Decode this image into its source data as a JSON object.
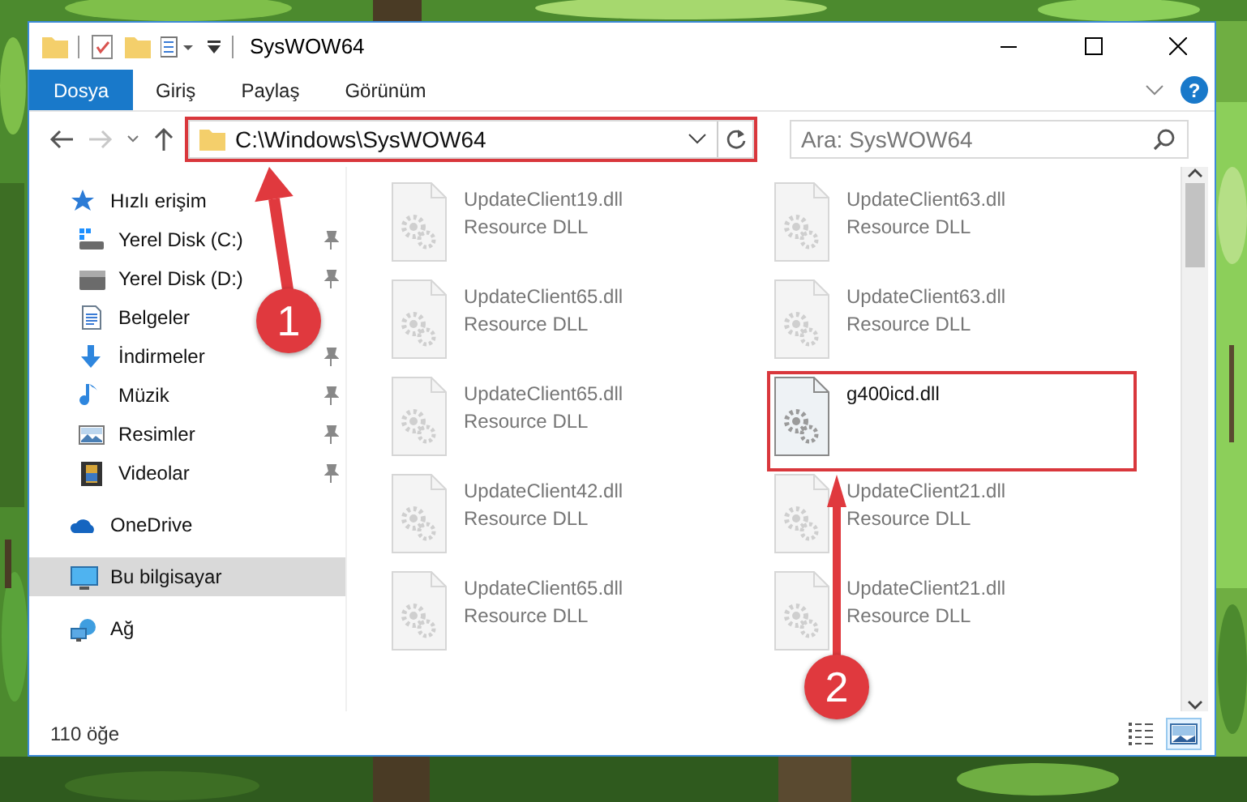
{
  "window": {
    "title": "SysWOW64"
  },
  "ribbon_tabs": [
    {
      "label": "Dosya",
      "selected": true
    },
    {
      "label": "Giriş",
      "selected": false
    },
    {
      "label": "Paylaş",
      "selected": false
    },
    {
      "label": "Görünüm",
      "selected": false
    }
  ],
  "help_button": {
    "label": "?"
  },
  "navigation": {
    "forward_disabled": true
  },
  "address_bar": {
    "path": "C:\\Windows\\SysWOW64",
    "highlighted": true
  },
  "search": {
    "placeholder": "Ara: SysWOW64"
  },
  "sidebar": {
    "items": [
      {
        "label": "Hızlı erişim",
        "kind": "star",
        "selected": false,
        "children": [
          {
            "label": "Yerel Disk (C:)",
            "kind": "drive-system",
            "pinned": true
          },
          {
            "label": "Yerel Disk (D:)",
            "kind": "drive",
            "pinned": true
          },
          {
            "label": "Belgeler",
            "kind": "documents"
          },
          {
            "label": "İndirmeler",
            "kind": "downloads",
            "pinned": true
          },
          {
            "label": "Müzik",
            "kind": "music",
            "pinned": true
          },
          {
            "label": "Resimler",
            "kind": "pictures",
            "pinned": true
          },
          {
            "label": "Videolar",
            "kind": "videos",
            "pinned": true
          }
        ]
      },
      {
        "label": "OneDrive",
        "kind": "cloud",
        "selected": false
      },
      {
        "label": "Bu bilgisayar",
        "kind": "computer",
        "selected": true
      },
      {
        "label": "Ağ",
        "kind": "network",
        "selected": false
      }
    ]
  },
  "files": [
    {
      "name": "UpdateClient19.dll",
      "type": "Resource DLL",
      "faded": true
    },
    {
      "name": "UpdateClient63.dll",
      "type": "Resource DLL",
      "faded": true
    },
    {
      "name": "UpdateClient65.dll",
      "type": "Resource DLL",
      "faded": true
    },
    {
      "name": "UpdateClient63.dll",
      "type": "Resource DLL",
      "faded": true
    },
    {
      "name": "UpdateClient65.dll",
      "type": "Resource DLL",
      "faded": true
    },
    {
      "name": "g400icd.dll",
      "faded": false,
      "highlighted": true
    },
    {
      "name": "UpdateClient42.dll",
      "type": "Resource DLL",
      "faded": true
    },
    {
      "name": "UpdateClient21.dll",
      "type": "Resource DLL",
      "faded": true
    },
    {
      "name": "UpdateClient65.dll",
      "type": "Resource DLL",
      "faded": true
    },
    {
      "name": "UpdateClient21.dll",
      "type": "Resource DLL",
      "faded": true
    }
  ],
  "status_bar": {
    "item_count": "110 öğe"
  },
  "view_buttons": [
    {
      "kind": "details",
      "selected": false
    },
    {
      "kind": "large-icons",
      "selected": true
    }
  ],
  "annotations": [
    {
      "number": "1"
    },
    {
      "number": "2"
    }
  ]
}
